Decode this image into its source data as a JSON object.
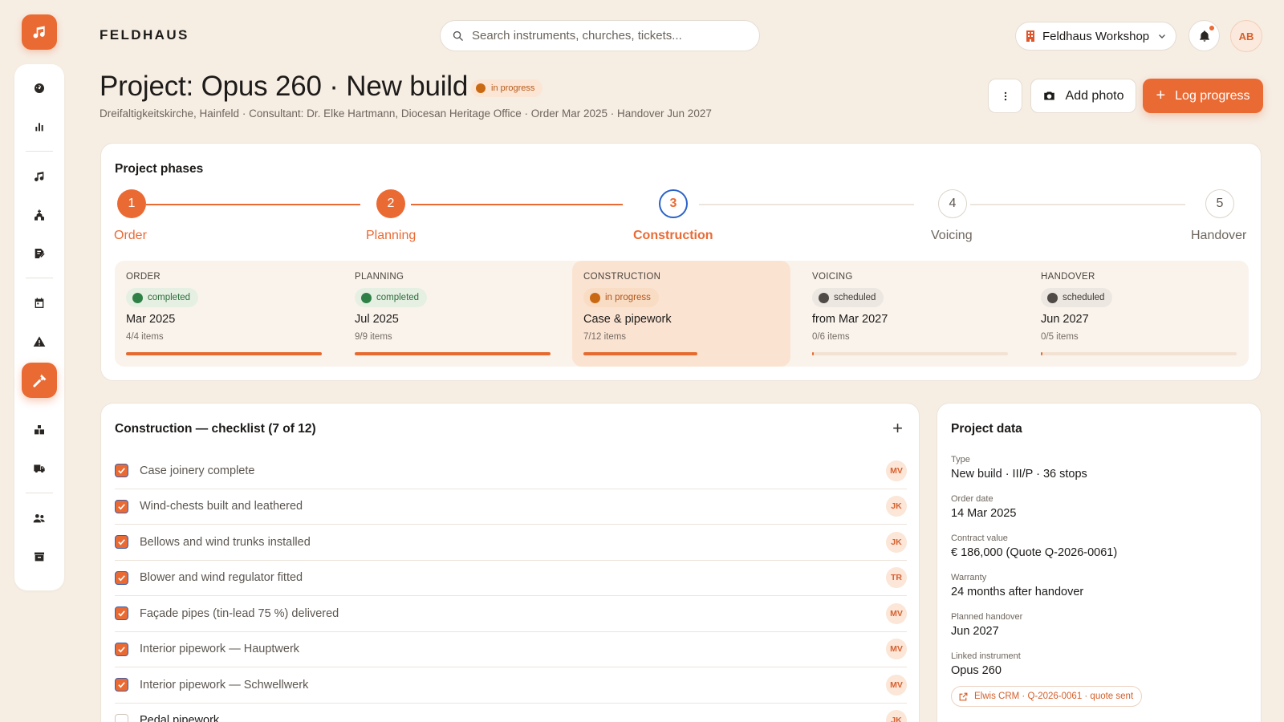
{
  "app": {
    "brand": "FELDHAUS"
  },
  "search": {
    "placeholder": "Search instruments, churches, tickets..."
  },
  "workshop": {
    "label": "Feldhaus Workshop"
  },
  "user": {
    "initials": "AB"
  },
  "header": {
    "title": "Project: Opus 260 · New build",
    "status": "in progress",
    "subtitle": "Dreifaltigkeitskirche, Hainfeld · Consultant: Dr. Elke Hartmann, Diocesan Heritage Office · Order Mar 2025 · Handover Jun 2027",
    "add_photo": "Add photo",
    "log_progress": "Log progress"
  },
  "sidebar": {
    "items": [
      {
        "icon": "dashboard-icon"
      },
      {
        "icon": "bar-chart-icon"
      },
      {
        "icon": "music-note-icon"
      },
      {
        "icon": "church-icon"
      },
      {
        "icon": "contract-icon"
      },
      {
        "icon": "calendar-icon"
      },
      {
        "icon": "warning-icon"
      },
      {
        "icon": "hammer-icon",
        "active": true
      },
      {
        "icon": "boxes-icon"
      },
      {
        "icon": "truck-icon"
      },
      {
        "icon": "users-icon"
      },
      {
        "icon": "archive-icon"
      }
    ]
  },
  "phases": {
    "title": "Project phases",
    "steps": [
      {
        "num": "1",
        "label": "Order",
        "state": "done"
      },
      {
        "num": "2",
        "label": "Planning",
        "state": "done"
      },
      {
        "num": "3",
        "label": "Construction",
        "state": "current"
      },
      {
        "num": "4",
        "label": "Voicing",
        "state": "future"
      },
      {
        "num": "5",
        "label": "Handover",
        "state": "future"
      }
    ],
    "boxes": [
      {
        "label": "ORDER",
        "status": "completed",
        "date": "Mar 2025",
        "items": "4/4 items",
        "progress": 1.0
      },
      {
        "label": "PLANNING",
        "status": "completed",
        "date": "Jul 2025",
        "items": "9/9 items",
        "progress": 1.0
      },
      {
        "label": "CONSTRUCTION",
        "status": "in progress",
        "date": "Case & pipework",
        "items": "7/12 items",
        "progress": 0.58
      },
      {
        "label": "VOICING",
        "status": "scheduled",
        "date": "from Mar 2027",
        "items": "0/6 items",
        "progress": 0
      },
      {
        "label": "HANDOVER",
        "status": "scheduled",
        "date": "Jun 2027",
        "items": "0/5 items",
        "progress": 0
      }
    ]
  },
  "checklist": {
    "title": "Construction — checklist (7 of 12)",
    "add": "+",
    "items": [
      {
        "text": "Case joinery complete",
        "assignee": "MV",
        "checked": true
      },
      {
        "text": "Wind-chests built and leathered",
        "assignee": "JK",
        "checked": true
      },
      {
        "text": "Bellows and wind trunks installed",
        "assignee": "JK",
        "checked": true
      },
      {
        "text": "Blower and wind regulator fitted",
        "assignee": "TR",
        "checked": true
      },
      {
        "text": "Façade pipes (tin-lead 75 %) delivered",
        "assignee": "MV",
        "checked": true
      },
      {
        "text": "Interior pipework — Hauptwerk",
        "assignee": "MV",
        "checked": true
      },
      {
        "text": "Interior pipework — Schwellwerk",
        "assignee": "MV",
        "checked": true
      },
      {
        "text": "Pedal pipework",
        "assignee": "JK",
        "checked": false
      }
    ]
  },
  "project_data": {
    "title": "Project data",
    "fields": [
      {
        "label": "Type",
        "value": "New build · III/P · 36 stops"
      },
      {
        "label": "Order date",
        "value": "14 Mar 2025"
      },
      {
        "label": "Contract value",
        "value": "€ 186,000 (Quote Q-2026-0061)"
      },
      {
        "label": "Warranty",
        "value": "24 months after handover"
      },
      {
        "label": "Planned handover",
        "value": "Jun 2027"
      },
      {
        "label": "Linked instrument",
        "value": "Opus 260"
      }
    ],
    "crm_link": "Elwis CRM · Q-2026-0061 · quote sent"
  },
  "colors": {
    "accent": "#ea6a34",
    "background": "#f6ede3",
    "completed": "#2e8046",
    "in_progress": "#c96a12"
  }
}
